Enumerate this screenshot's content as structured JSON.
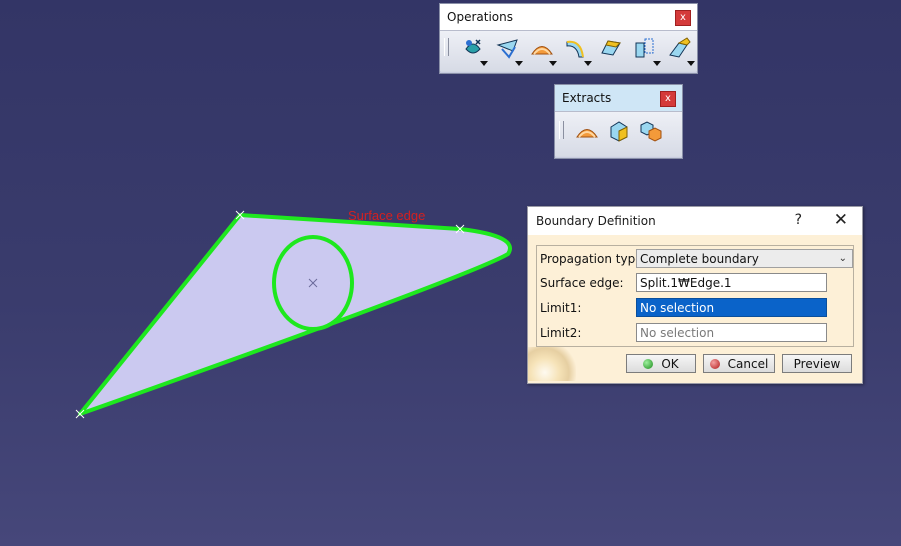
{
  "viewport": {
    "annotation": "Surface edge",
    "colors": {
      "background": "#383a6b",
      "surface": "#cbc9f0",
      "edge": "#1ee81e",
      "annotation": "#d42020"
    }
  },
  "operations": {
    "title": "Operations",
    "close_label": "x",
    "icons": [
      "join-icon",
      "healing-icon",
      "boundary-icon",
      "fillet-icon",
      "split-icon",
      "translate-icon",
      "extrapolate-icon"
    ]
  },
  "extracts": {
    "title": "Extracts",
    "close_label": "x",
    "icons": [
      "boundary-icon",
      "extract-icon",
      "multiple-extract-icon"
    ]
  },
  "dialog": {
    "title": "Boundary Definition",
    "help_label": "?",
    "close_label": "✕",
    "propagation_label": "Propagation type:",
    "propagation_value": "Complete boundary",
    "surface_edge_label": "Surface edge:",
    "surface_edge_value": "Split.1₩Edge.1",
    "limit1_label": "Limit1:",
    "limit1_value": "No selection",
    "limit2_label": "Limit2:",
    "limit2_value": "No selection",
    "ok_label": "OK",
    "cancel_label": "Cancel",
    "preview_label": "Preview"
  }
}
